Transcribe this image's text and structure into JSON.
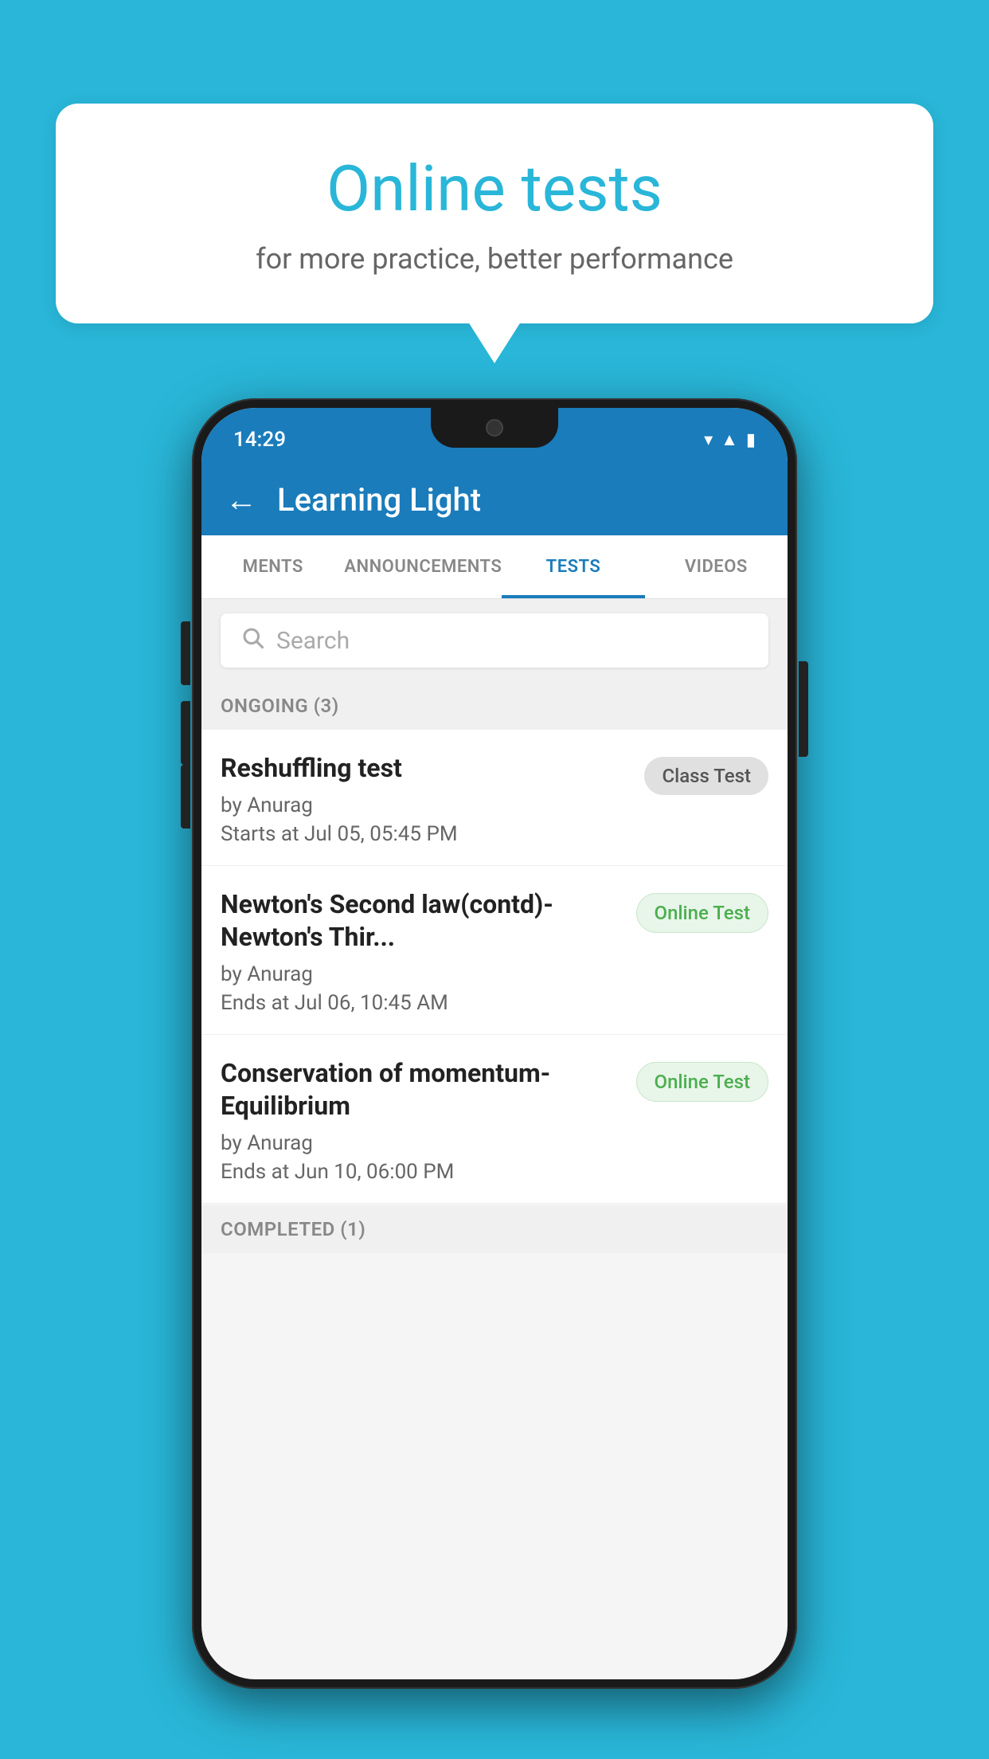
{
  "background_color": "#29b6d8",
  "bubble": {
    "title": "Online tests",
    "subtitle": "for more practice, better performance"
  },
  "phone": {
    "status_bar": {
      "time": "14:29",
      "wifi": "▾",
      "signal": "▲",
      "battery": "▮"
    },
    "header": {
      "back_label": "←",
      "title": "Learning Light"
    },
    "tabs": [
      {
        "id": "ments",
        "label": "MENTS",
        "active": false
      },
      {
        "id": "announcements",
        "label": "ANNOUNCEMENTS",
        "active": false
      },
      {
        "id": "tests",
        "label": "TESTS",
        "active": true
      },
      {
        "id": "videos",
        "label": "VIDEOS",
        "active": false
      }
    ],
    "search": {
      "placeholder": "Search"
    },
    "ongoing_section": {
      "label": "ONGOING (3)"
    },
    "test_items": [
      {
        "id": "reshuffling-test",
        "title": "Reshuffling test",
        "author": "by Anurag",
        "date_label": "Starts at  Jul 05, 05:45 PM",
        "badge": "Class Test",
        "badge_type": "class"
      },
      {
        "id": "newtons-second",
        "title": "Newton's Second law(contd)-Newton's Thir...",
        "author": "by Anurag",
        "date_label": "Ends at  Jul 06, 10:45 AM",
        "badge": "Online Test",
        "badge_type": "online"
      },
      {
        "id": "conservation",
        "title": "Conservation of momentum-Equilibrium",
        "author": "by Anurag",
        "date_label": "Ends at  Jun 10, 06:00 PM",
        "badge": "Online Test",
        "badge_type": "online"
      }
    ],
    "completed_section": {
      "label": "COMPLETED (1)"
    }
  }
}
